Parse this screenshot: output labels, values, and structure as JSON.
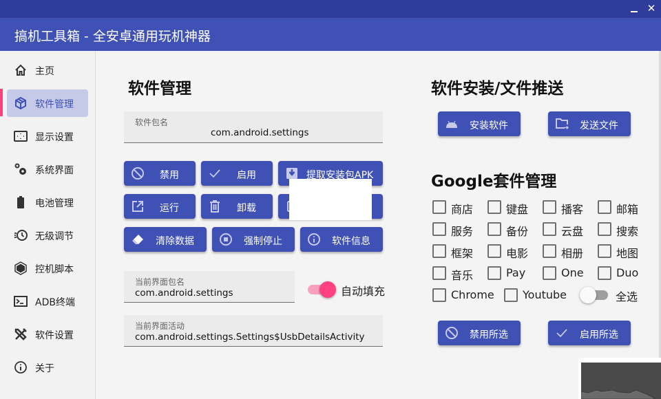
{
  "window": {
    "minimize_icon": "minimize-icon",
    "close_icon": "close-icon",
    "close_glyph": "✕"
  },
  "app": {
    "title": "搞机工具箱 - 全安卓通用玩机神器"
  },
  "colors": {
    "primary": "#3f51b5",
    "titlebar": "#2f3c9c",
    "accent": "#ff4081",
    "nav_active_bg": "#c5cae9"
  },
  "sidebar": {
    "active_index": 1,
    "items": [
      {
        "label": "主页",
        "icon": "home-icon"
      },
      {
        "label": "软件管理",
        "icon": "package-icon"
      },
      {
        "label": "显示设置",
        "icon": "display-icon"
      },
      {
        "label": "系统界面",
        "icon": "gears-icon"
      },
      {
        "label": "电池管理",
        "icon": "battery-icon"
      },
      {
        "label": "无级调节",
        "icon": "clock-adjust-icon"
      },
      {
        "label": "控机脚本",
        "icon": "hexagon-icon"
      },
      {
        "label": "ADB终端",
        "icon": "terminal-icon"
      },
      {
        "label": "软件设置",
        "icon": "tools-icon"
      },
      {
        "label": "关于",
        "icon": "info-icon"
      }
    ]
  },
  "app_manager": {
    "title": "软件管理",
    "package_field": {
      "label": "软件包名",
      "value": "com.android.settings"
    },
    "buttons_row1": [
      {
        "label": "禁用",
        "icon": "block-icon"
      },
      {
        "label": "启用",
        "icon": "check-icon"
      },
      {
        "label": "提取安装包APK",
        "icon": "download-box-icon"
      }
    ],
    "buttons_row2": [
      {
        "label": "运行",
        "icon": "open-external-icon"
      },
      {
        "label": "卸载",
        "icon": "trash-icon"
      },
      {
        "label": "",
        "icon": "unknown-icon"
      }
    ],
    "buttons_row3": [
      {
        "label": "清除数据",
        "icon": "eraser-icon"
      },
      {
        "label": "强制停止",
        "icon": "stop-circle-icon"
      },
      {
        "label": "软件信息",
        "icon": "info-icon"
      }
    ],
    "current_package_field": {
      "label": "当前界面包名",
      "value": "com.android.settings"
    },
    "autofill_toggle": {
      "label": "自动填充",
      "on": true
    },
    "current_activity_field": {
      "label": "当前界面活动",
      "value": "com.android.settings.Settings$UsbDetailsActivity"
    }
  },
  "install_push": {
    "title": "软件安装/文件推送",
    "install_button": {
      "label": "安装软件",
      "icon": "android-icon"
    },
    "push_button": {
      "label": "发送文件",
      "icon": "folder-send-icon"
    }
  },
  "google_suite": {
    "title": "Google套件管理",
    "checkboxes": [
      {
        "label": "商店",
        "checked": false
      },
      {
        "label": "键盘",
        "checked": false
      },
      {
        "label": "播客",
        "checked": false
      },
      {
        "label": "邮箱",
        "checked": false
      },
      {
        "label": "服务",
        "checked": false
      },
      {
        "label": "备份",
        "checked": false
      },
      {
        "label": "云盘",
        "checked": false
      },
      {
        "label": "搜索",
        "checked": false
      },
      {
        "label": "框架",
        "checked": false
      },
      {
        "label": "电影",
        "checked": false
      },
      {
        "label": "相册",
        "checked": false
      },
      {
        "label": "地图",
        "checked": false
      },
      {
        "label": "音乐",
        "checked": false
      },
      {
        "label": "Pay",
        "checked": false
      },
      {
        "label": "One",
        "checked": false
      },
      {
        "label": "Duo",
        "checked": false
      },
      {
        "label": "Chrome",
        "checked": false
      },
      {
        "label": "Youtube",
        "checked": false
      }
    ],
    "select_all_toggle": {
      "label": "全选",
      "on": false
    },
    "disable_selected": {
      "label": "禁用所选",
      "icon": "block-icon"
    },
    "enable_selected": {
      "label": "启用所选",
      "icon": "check-icon"
    }
  }
}
